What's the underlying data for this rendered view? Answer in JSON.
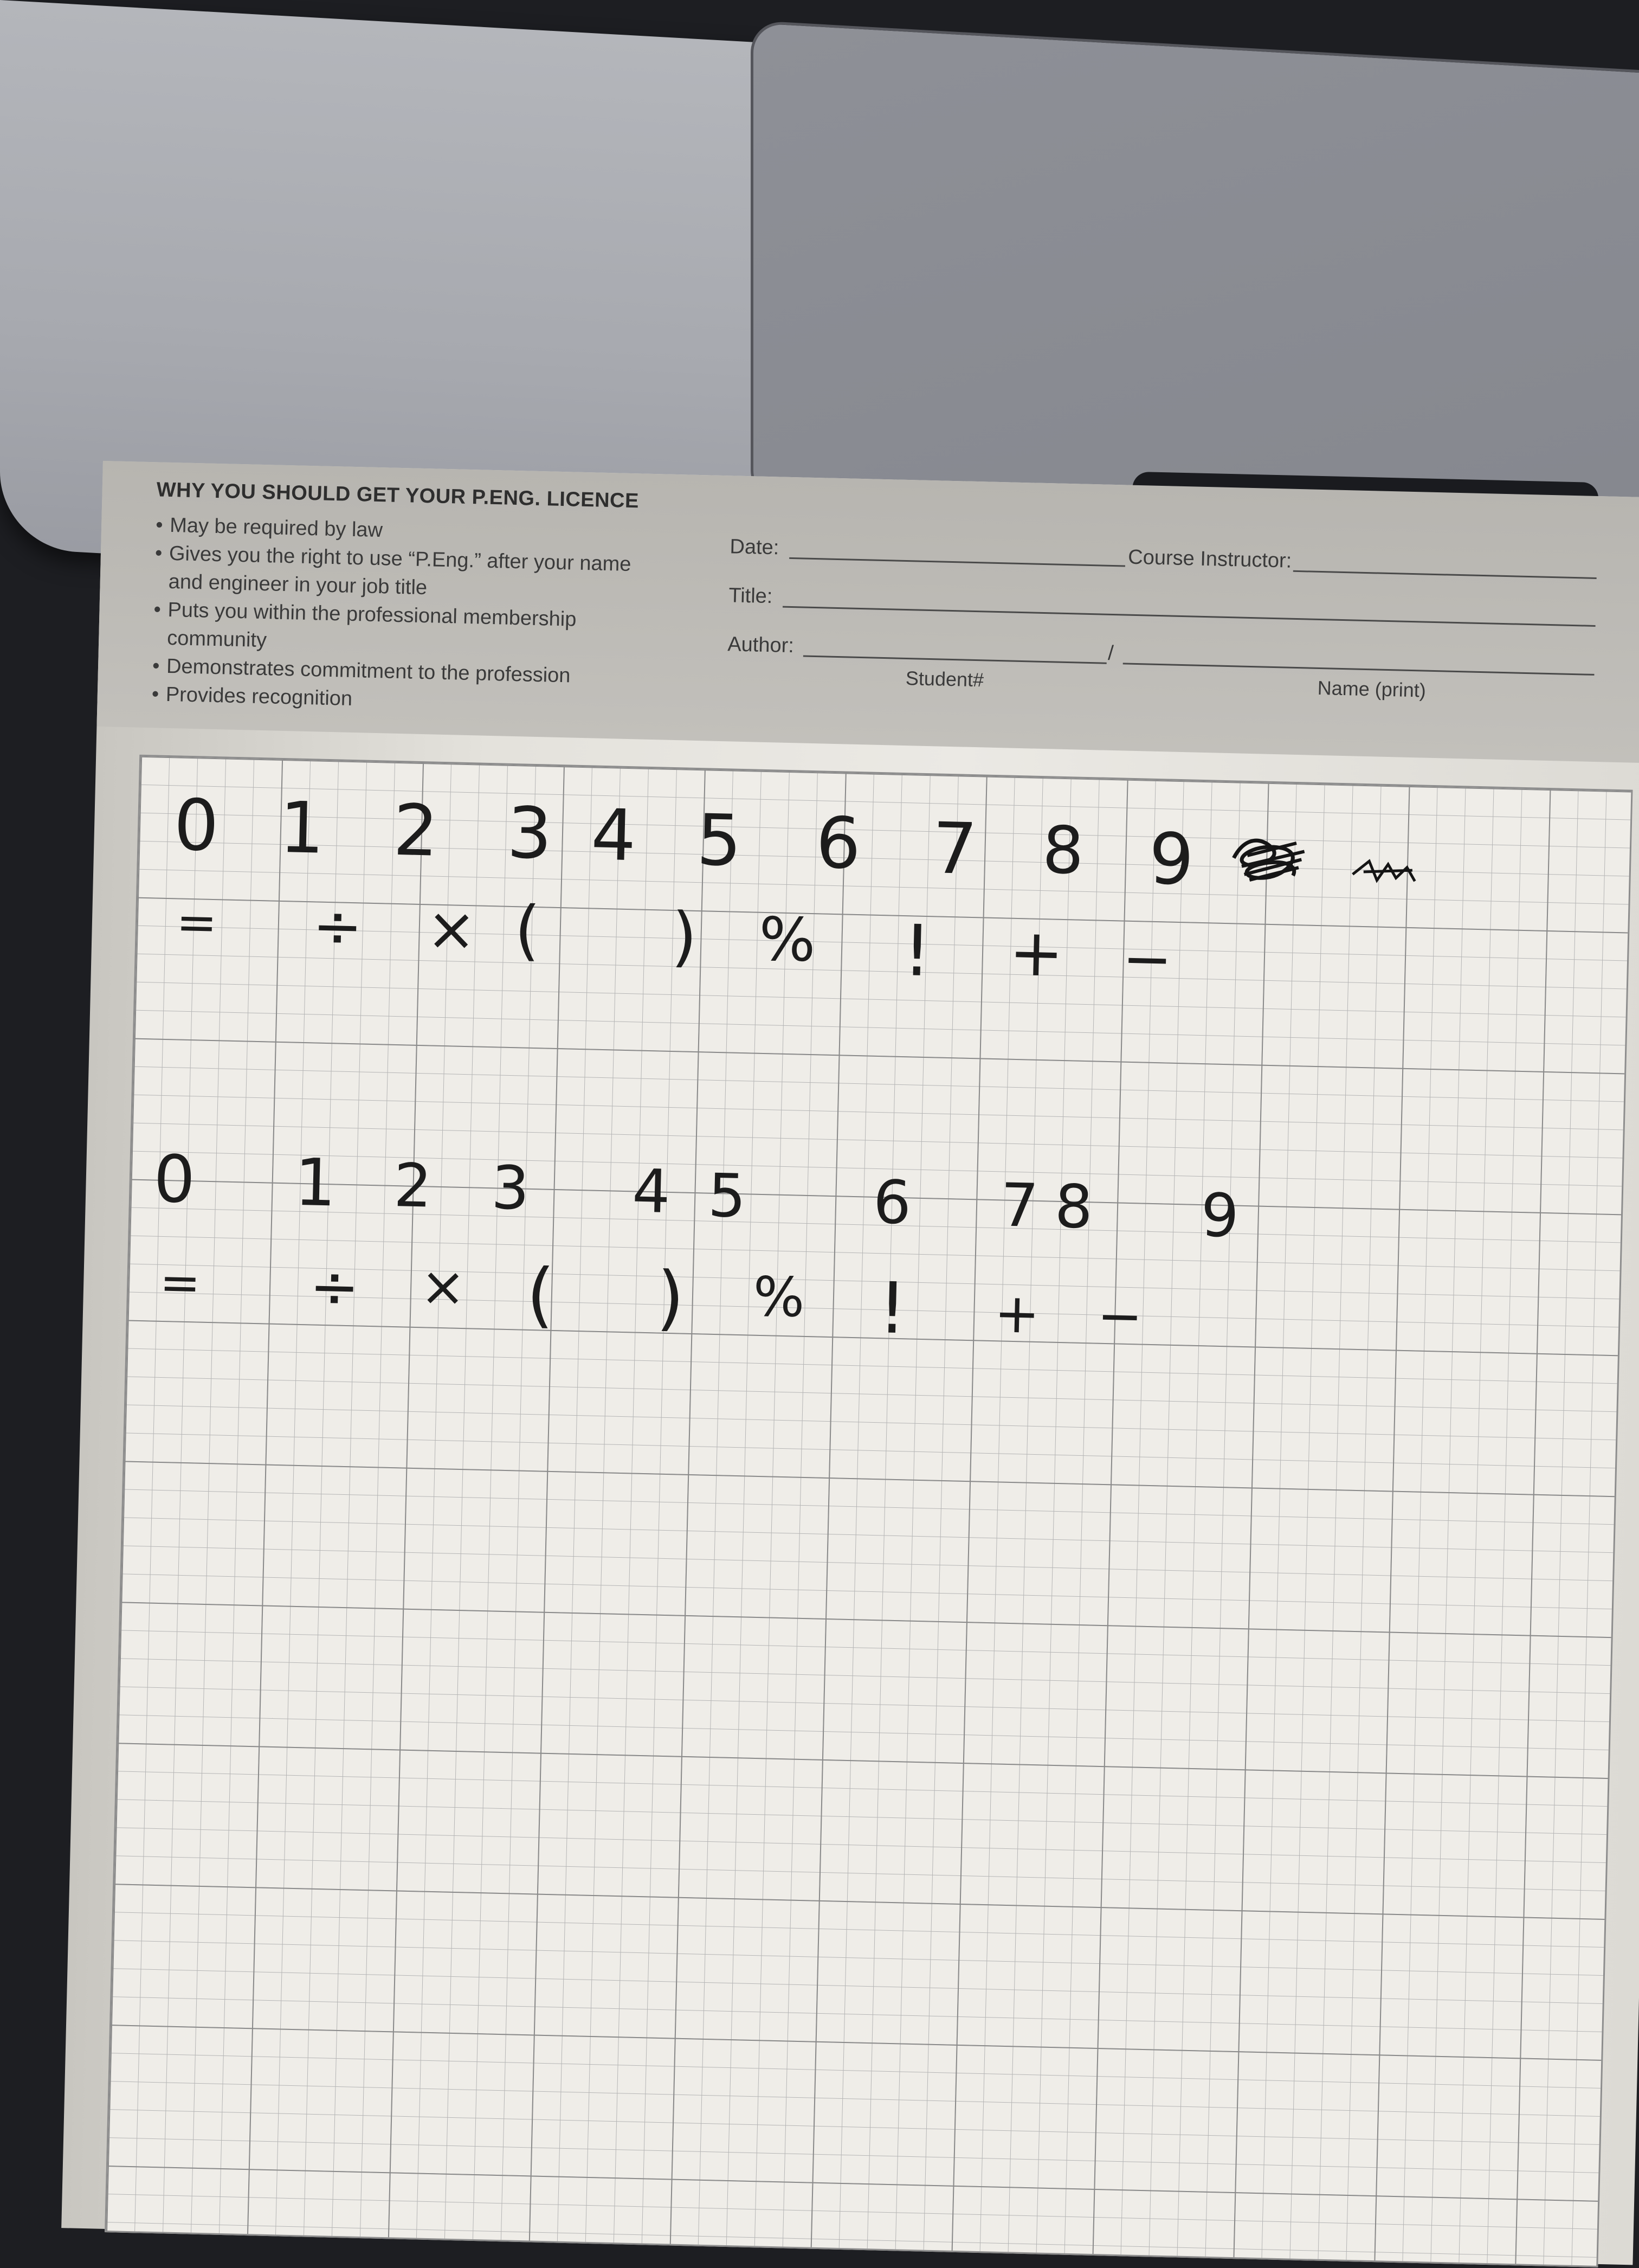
{
  "sheet": {
    "heading": "WHY YOU SHOULD GET YOUR P.ENG. LICENCE",
    "bullet_symbol": "•",
    "bullets": [
      "May be required by law",
      "Gives you the right to use “P.Eng.” after your name and engineer in your job title",
      "Puts you within the professional membership community",
      "Demonstrates commitment to the profession",
      "Provides recognition"
    ],
    "form": {
      "date_label": "Date:",
      "course_instructor_label": "Course Instructor:",
      "title_label": "Title:",
      "author_label": "Author:",
      "author_separator": "/",
      "student_number_caption": "Student#",
      "name_caption": "Name (print)"
    }
  },
  "handwriting": {
    "row1_digits": [
      "0",
      "1",
      "2",
      "3",
      "4",
      "5",
      "6",
      "7",
      "8",
      "9"
    ],
    "row1_symbols": [
      "=",
      "÷",
      "×",
      "(",
      ")",
      "%",
      "!",
      "+",
      "−"
    ],
    "row2_digits": [
      "0",
      "1",
      "2",
      "3",
      "4",
      "5",
      "6",
      "7",
      "8",
      "9"
    ],
    "row2_symbols": [
      "=",
      "÷",
      "×",
      "(",
      ")",
      "%",
      "!",
      "+",
      "−"
    ]
  }
}
